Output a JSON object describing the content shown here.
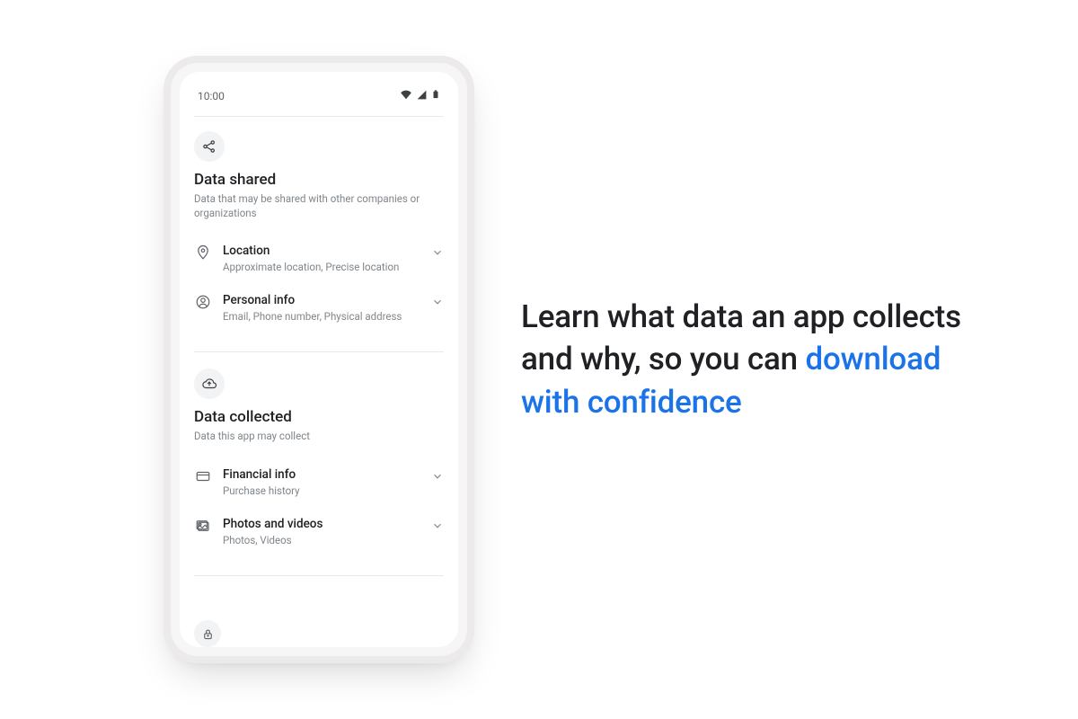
{
  "statusbar": {
    "time": "10:00"
  },
  "sections": {
    "shared": {
      "title": "Data shared",
      "subtitle": "Data that may be shared with other companies or organizations",
      "items": [
        {
          "title": "Location",
          "subtitle": "Approximate location, Precise location"
        },
        {
          "title": "Personal info",
          "subtitle": "Email, Phone number, Physical address"
        }
      ]
    },
    "collected": {
      "title": "Data collected",
      "subtitle": "Data this app may collect",
      "items": [
        {
          "title": "Financial info",
          "subtitle": "Purchase history"
        },
        {
          "title": "Photos and videos",
          "subtitle": "Photos, Videos"
        }
      ]
    }
  },
  "headline": {
    "line1": "Learn what data an app collects and why, so you can ",
    "accent": "download with confidence"
  },
  "colors": {
    "accent": "#1a73e8",
    "text": "#202124",
    "muted": "#80868b"
  }
}
